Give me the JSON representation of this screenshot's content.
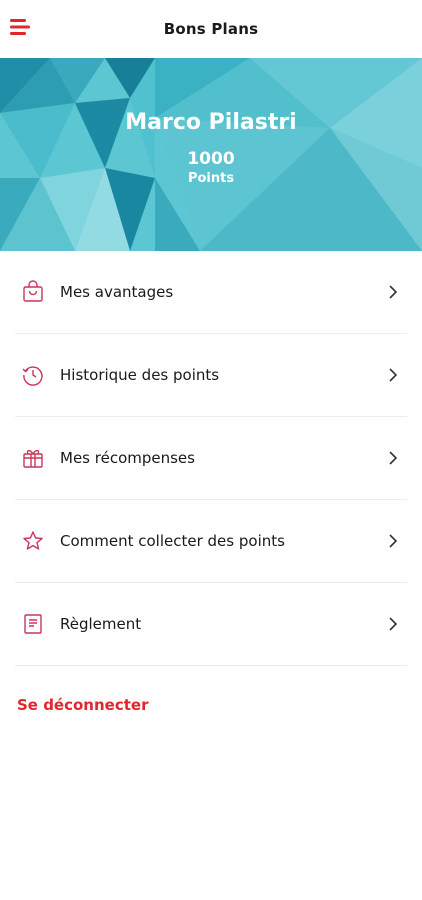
{
  "header": {
    "title": "Bons Plans",
    "menu_icon": "hamburger-icon"
  },
  "profile": {
    "name": "Marco Pilastri",
    "points": "1000",
    "points_label": "Points"
  },
  "menu": {
    "items": [
      {
        "label": "Mes avantages",
        "icon": "shopping-bag-icon"
      },
      {
        "label": "Historique des points",
        "icon": "history-icon"
      },
      {
        "label": "Mes récompenses",
        "icon": "gift-icon"
      },
      {
        "label": "Comment collecter des points",
        "icon": "star-icon"
      },
      {
        "label": "Règlement",
        "icon": "document-icon"
      }
    ]
  },
  "logout": {
    "label": "Se déconnecter"
  },
  "colors": {
    "accent": "#e3262c",
    "icon": "#c8375a",
    "hero": "#46b6c6"
  }
}
